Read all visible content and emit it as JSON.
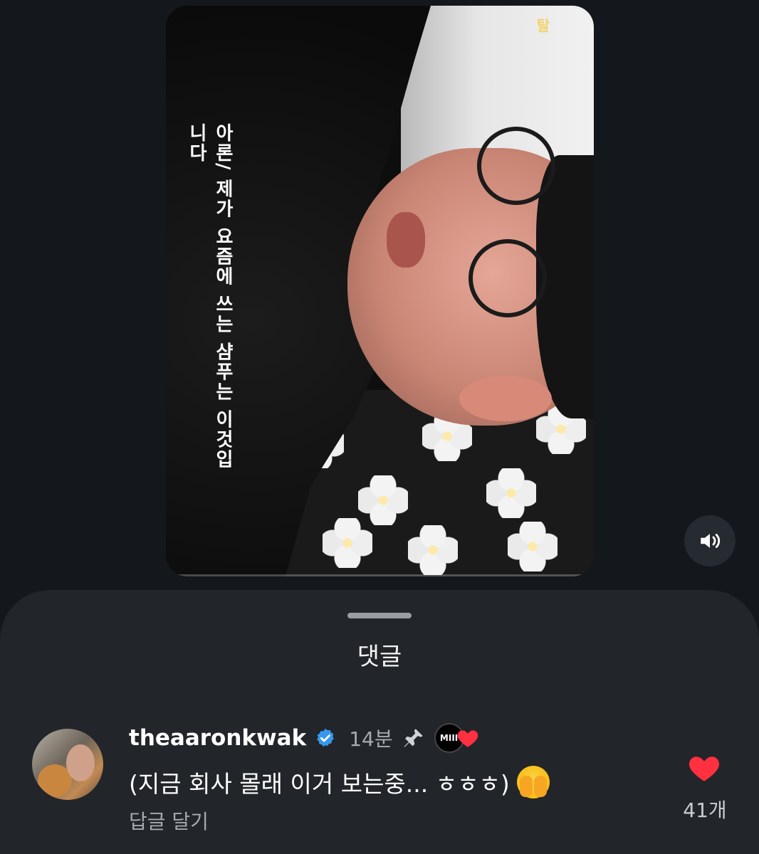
{
  "video": {
    "subtitle": "아론/ 제가 요즘에 쓰는 샴푸는 이것입니다",
    "channel_logo": "탈"
  },
  "controls": {
    "sound_icon": "speaker-volume-icon"
  },
  "comments_sheet": {
    "title": "댓글",
    "comments": [
      {
        "username": "theaaronkwak",
        "verified": true,
        "time": "14분",
        "pinned": true,
        "badge_text": "MIII",
        "text": "(지금 회사 몰래 이거 보는중... ㅎㅎㅎ)",
        "emoji": "face-with-hand-over-eyes",
        "reply_label": "답글 달기",
        "like_count": "41개"
      }
    ]
  },
  "colors": {
    "background": "#14171c",
    "sheet": "#222529",
    "verified": "#3897f0",
    "like": "#ff3040",
    "muted_text": "#a7abb0"
  }
}
